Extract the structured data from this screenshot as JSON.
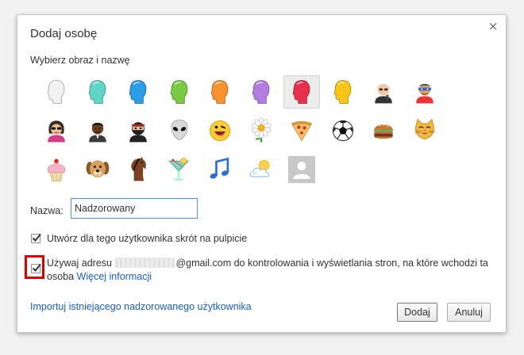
{
  "dialog": {
    "title": "Dodaj osobę",
    "close_glyph": "×",
    "subtitle": "Wybierz obraz i nazwę"
  },
  "avatars": [
    {
      "name": "avatar-head-white-icon",
      "kind": "head",
      "color": "#f2f2f2",
      "selected": false
    },
    {
      "name": "avatar-head-cyan-icon",
      "kind": "head",
      "color": "#5fd5c8",
      "selected": false
    },
    {
      "name": "avatar-head-blue-icon",
      "kind": "head",
      "color": "#2a9ce8",
      "selected": false
    },
    {
      "name": "avatar-head-green-icon",
      "kind": "head",
      "color": "#7ac943",
      "selected": false
    },
    {
      "name": "avatar-head-orange-icon",
      "kind": "head",
      "color": "#f7922d",
      "selected": false
    },
    {
      "name": "avatar-head-purple-icon",
      "kind": "head",
      "color": "#b27de1",
      "selected": false
    },
    {
      "name": "avatar-head-red-icon",
      "kind": "head",
      "color": "#e8304a",
      "selected": true
    },
    {
      "name": "avatar-head-yellow-icon",
      "kind": "head",
      "color": "#f5c518",
      "selected": false
    },
    {
      "name": "avatar-businesswoman-icon",
      "kind": "businesswoman",
      "color": "#f0c070",
      "selected": false
    },
    {
      "name": "avatar-superhero-icon",
      "kind": "superhero",
      "color": "#2f5fc8",
      "selected": false
    },
    {
      "name": "avatar-woman-sunglasses-icon",
      "kind": "woman",
      "color": "#3a2a20",
      "selected": false
    },
    {
      "name": "avatar-man-icon",
      "kind": "man",
      "color": "#6b3e22",
      "selected": false
    },
    {
      "name": "avatar-ninja-icon",
      "kind": "ninja",
      "color": "#222222",
      "selected": false
    },
    {
      "name": "avatar-alien-icon",
      "kind": "alien",
      "color": "#d9d9d9",
      "selected": false
    },
    {
      "name": "avatar-smiley-icon",
      "kind": "smiley",
      "color": "#ffcc33",
      "selected": false
    },
    {
      "name": "avatar-flower-icon",
      "kind": "flower",
      "color": "#ffffff",
      "selected": false
    },
    {
      "name": "avatar-pizza-icon",
      "kind": "pizza",
      "color": "#f3c46a",
      "selected": false
    },
    {
      "name": "avatar-soccer-ball-icon",
      "kind": "ball",
      "color": "#ffffff",
      "selected": false
    },
    {
      "name": "avatar-burger-icon",
      "kind": "burger",
      "color": "#c47a2a",
      "selected": false
    },
    {
      "name": "avatar-cat-icon",
      "kind": "cat",
      "color": "#f5b640",
      "selected": false
    },
    {
      "name": "avatar-cupcake-icon",
      "kind": "cupcake",
      "color": "#f6b4c4",
      "selected": false
    },
    {
      "name": "avatar-dog-icon",
      "kind": "dog",
      "color": "#d9a05b",
      "selected": false
    },
    {
      "name": "avatar-horse-icon",
      "kind": "horse",
      "color": "#7a4422",
      "selected": false
    },
    {
      "name": "avatar-cocktail-icon",
      "kind": "cocktail",
      "color": "#7fd8c8",
      "selected": false
    },
    {
      "name": "avatar-music-note-icon",
      "kind": "note",
      "color": "#2d6fd8",
      "selected": false
    },
    {
      "name": "avatar-sun-cloud-icon",
      "kind": "suncloud",
      "color": "#ffd24a",
      "selected": false
    },
    {
      "name": "avatar-generic-person-icon",
      "kind": "generic",
      "color": "#c8c8c8",
      "selected": false
    }
  ],
  "name_field": {
    "label": "Nazwa:",
    "value": "Nadzorowany"
  },
  "shortcut_option": {
    "label": "Utwórz dla tego użytkownika skrót na pulpicie",
    "checked": true
  },
  "supervise_option": {
    "checked": true,
    "prefix": "Używaj adresu",
    "suffix": "@gmail.com do kontrolowania i wyświetlania stron, na które wchodzi ta",
    "line2": "osoba",
    "link": "Więcej informacji"
  },
  "import_link": "Importuj istniejącego nadzorowanego użytkownika",
  "buttons": {
    "add": "Dodaj",
    "cancel": "Anuluj"
  },
  "colors": {
    "link": "#1a5ec7",
    "focus_border": "#4d90fe",
    "highlight_border": "#e00000"
  }
}
